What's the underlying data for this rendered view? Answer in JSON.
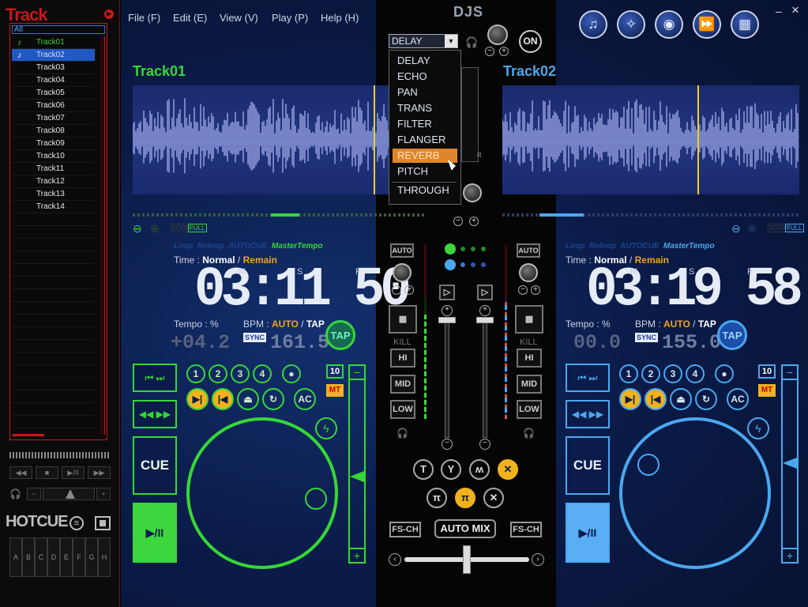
{
  "app": {
    "logo": "DJS"
  },
  "menu": [
    "File (F)",
    "Edit (E)",
    "View (V)",
    "Play (P)",
    "Help (H)"
  ],
  "window": {
    "minimize": "–",
    "close": "×"
  },
  "track_panel": {
    "title": "Track",
    "filter": "All",
    "tracks": [
      "Track01",
      "Track02",
      "Track03",
      "Track04",
      "Track05",
      "Track06",
      "Track07",
      "Track08",
      "Track09",
      "Track10",
      "Track11",
      "Track12",
      "Track13",
      "Track14"
    ],
    "playing_index": 0,
    "selected_index": 1,
    "transport": [
      "◀◀",
      "■",
      "▶/II",
      "▶▶"
    ],
    "volume_minus": "−",
    "volume_plus": "+"
  },
  "hotcue": {
    "title": "HOTCUE",
    "keys": [
      "A",
      "B",
      "C",
      "D",
      "E",
      "F",
      "G",
      "H"
    ]
  },
  "effect": {
    "selected": "DELAY",
    "options": [
      "DELAY",
      "ECHO",
      "PAN",
      "TRANS",
      "FILTER",
      "FLANGER",
      "REVERB",
      "PITCH",
      "THROUGH"
    ],
    "highlighted": "REVERB",
    "on_label": "ON"
  },
  "deck_a": {
    "title": "Track01",
    "color": "#35d835",
    "legend": [
      "Loop",
      "Reloop",
      "AUTOCUE",
      "MasterTempo"
    ],
    "time_label": "Time :",
    "time_mode_normal": "Normal",
    "time_mode_sep": "/",
    "time_mode_remain": "Remain",
    "time": "03:11 50",
    "m": "M",
    "s": "S",
    "f": "F",
    "tempo_label": "Tempo : %",
    "tempo": "+04.2",
    "bpm_label": "BPM :",
    "bpm_auto": "AUTO",
    "bpm_tap": "TAP",
    "sync": "SYNC",
    "bpm": "161.5",
    "tap": "TAP",
    "cue": "CUE",
    "play": "▶/II",
    "hotcues": [
      "1",
      "2",
      "3",
      "4"
    ],
    "ac": "AC",
    "pitch_range": "10",
    "mt": "MT",
    "pitch_minus": "−",
    "pitch_plus": "+",
    "zoom": "ZOOM",
    "full": "FULL",
    "pitch_position": 0.58,
    "position": 0.52
  },
  "deck_b": {
    "title": "Track02",
    "color": "#4aa8f0",
    "legend": [
      "Loop",
      "Reloop",
      "AUTOCUE",
      "MasterTempo"
    ],
    "time_label": "Time :",
    "time_mode_normal": "Normal",
    "time_mode_sep": "/",
    "time_mode_remain": "Remain",
    "time": "03:19 58",
    "m": "M",
    "s": "S",
    "f": "F",
    "tempo_label": "Tempo : %",
    "tempo": "00.0",
    "bpm_label": "BPM :",
    "bpm_auto": "AUTO",
    "bpm_tap": "TAP",
    "sync": "SYNC",
    "bpm": "155.0",
    "tap": "TAP",
    "cue": "CUE",
    "play": "▶/II",
    "hotcues": [
      "1",
      "2",
      "3",
      "4"
    ],
    "ac": "AC",
    "pitch_range": "10",
    "mt": "MT",
    "pitch_minus": "−",
    "pitch_plus": "+",
    "zoom": "ZOOM",
    "full": "FULL",
    "pitch_position": 0.5,
    "position": 0.2
  },
  "mixer": {
    "auto": "AUTO",
    "kill": "KILL",
    "eq": [
      "HI",
      "MID",
      "LOW"
    ],
    "fs_ch": "FS-CH",
    "auto_mix": "AUTO MIX"
  }
}
